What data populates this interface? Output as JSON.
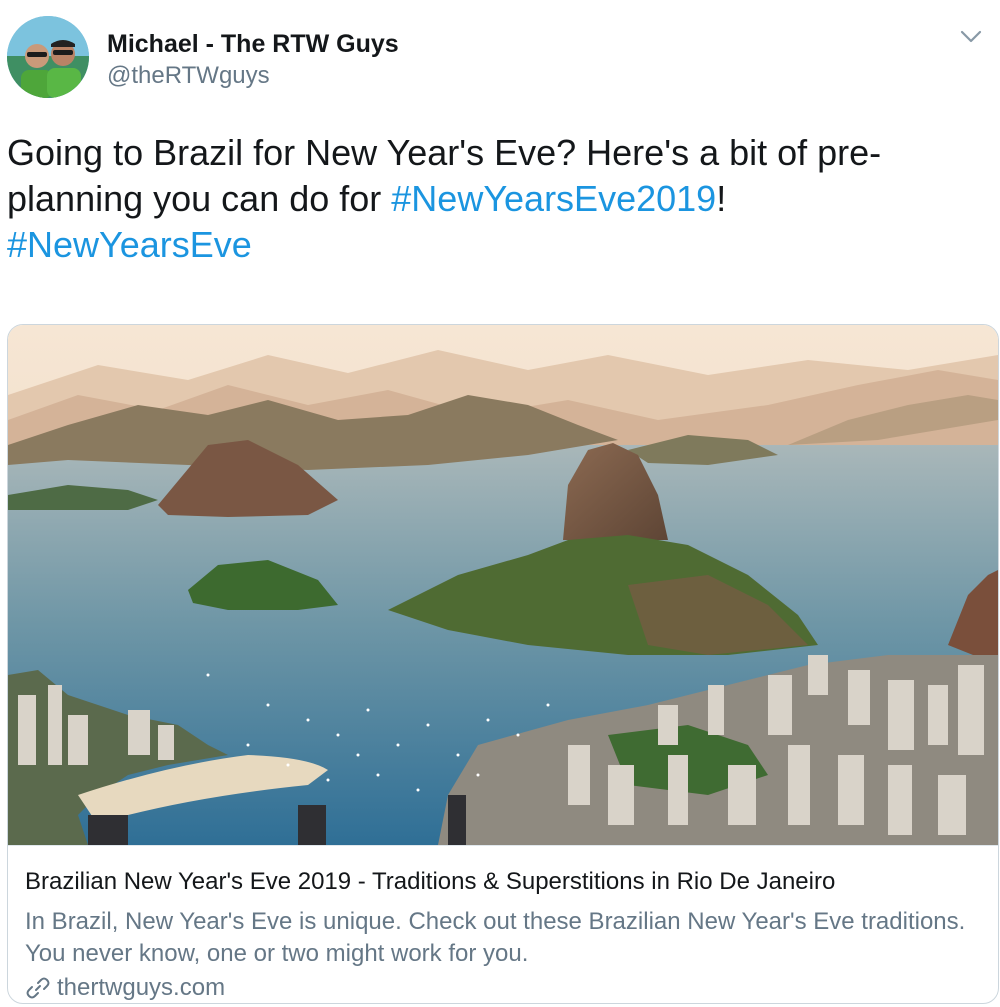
{
  "author": {
    "name": "Michael - The RTW Guys",
    "handle": "@theRTWguys"
  },
  "tweet": {
    "text_part1": "Going to Brazil for New Year's Eve? Here's a bit of pre-planning you can do for ",
    "hashtag1": "#NewYearsEve2019",
    "text_part2": "!",
    "hashtag2": "#NewYearsEve"
  },
  "card": {
    "title": "Brazilian New Year's Eve 2019 - Traditions & Superstitions in Rio De Janeiro",
    "description": "In Brazil, New Year's Eve is unique. Check out these Brazilian New Year's Eve traditions. You never know, one or two might work for you.",
    "domain": "thertwguys.com"
  },
  "icons": {
    "menu": "chevron-down-icon",
    "link": "link-icon"
  },
  "colors": {
    "link": "#1b95e0",
    "secondary_text": "#657786",
    "primary_text": "#14171a"
  }
}
